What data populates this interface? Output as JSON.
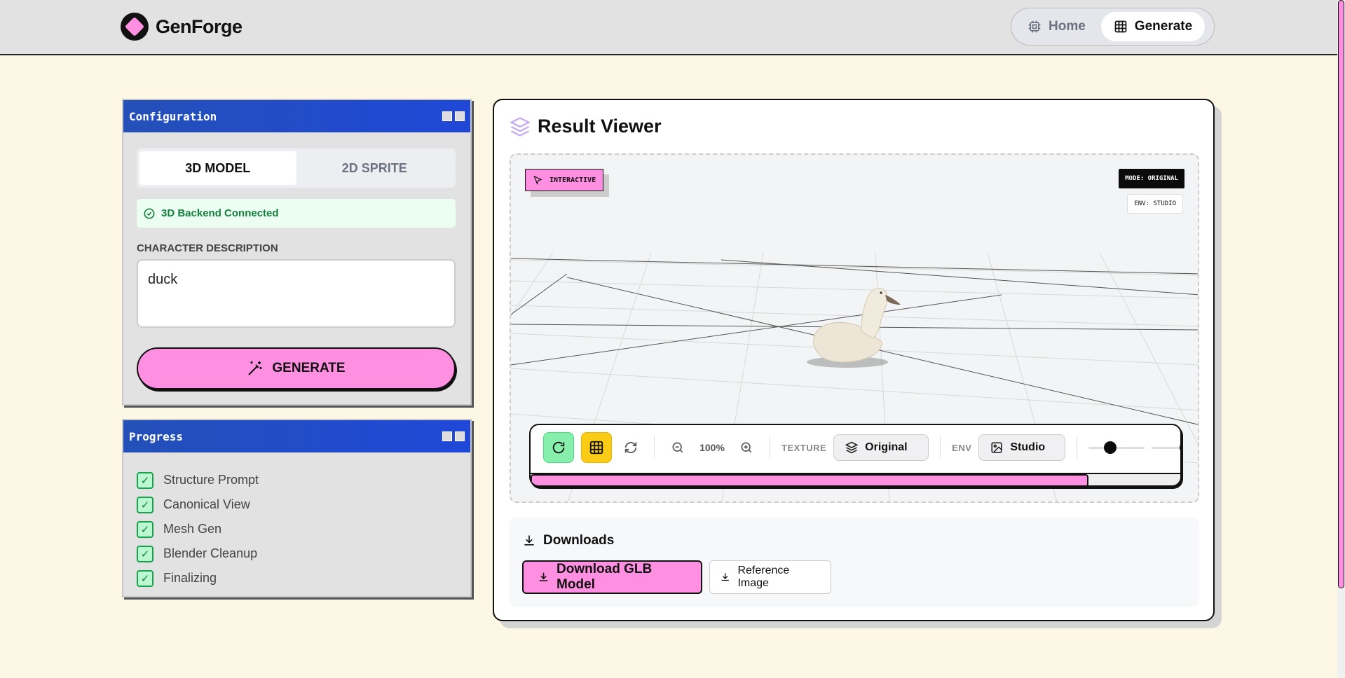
{
  "header": {
    "logo_text": "GenForge",
    "nav": [
      {
        "label": "Home",
        "icon": "cpu-icon",
        "active": false
      },
      {
        "label": "Generate",
        "icon": "grid-icon",
        "active": true
      }
    ]
  },
  "config": {
    "title": "Configuration",
    "tabs": [
      {
        "label": "3D MODEL",
        "active": true
      },
      {
        "label": "2D SPRITE",
        "active": false
      }
    ],
    "status": "3D Backend Connected",
    "field_label": "CHARACTER DESCRIPTION",
    "description_value": "duck",
    "generate_label": "GENERATE"
  },
  "progress": {
    "title": "Progress",
    "steps": [
      {
        "label": "Structure Prompt",
        "done": true
      },
      {
        "label": "Canonical View",
        "done": true
      },
      {
        "label": "Mesh Gen",
        "done": true
      },
      {
        "label": "Blender Cleanup",
        "done": true
      },
      {
        "label": "Finalizing",
        "done": true
      }
    ]
  },
  "viewer": {
    "title": "Result Viewer",
    "badge_interactive": "INTERACTIVE",
    "badge_mode": "MODE: ORIGINAL",
    "badge_env": "ENV: STUDIO",
    "toolbar": {
      "zoom": "100%",
      "texture_label": "TEXTURE",
      "texture_value": "Original",
      "env_label": "ENV",
      "env_value": "Studio",
      "brightness_level": 0.35,
      "spread_level": 0.65,
      "progress_fraction": 0.855
    }
  },
  "downloads": {
    "title": "Downloads",
    "glb_label": "Download GLB Model",
    "ref_label": "Reference Image"
  },
  "colors": {
    "accent_pink": "#ff8fe0",
    "title_blue": "#1f48d8",
    "success_green": "#15803d",
    "cream_background": "#fdf7e6"
  }
}
